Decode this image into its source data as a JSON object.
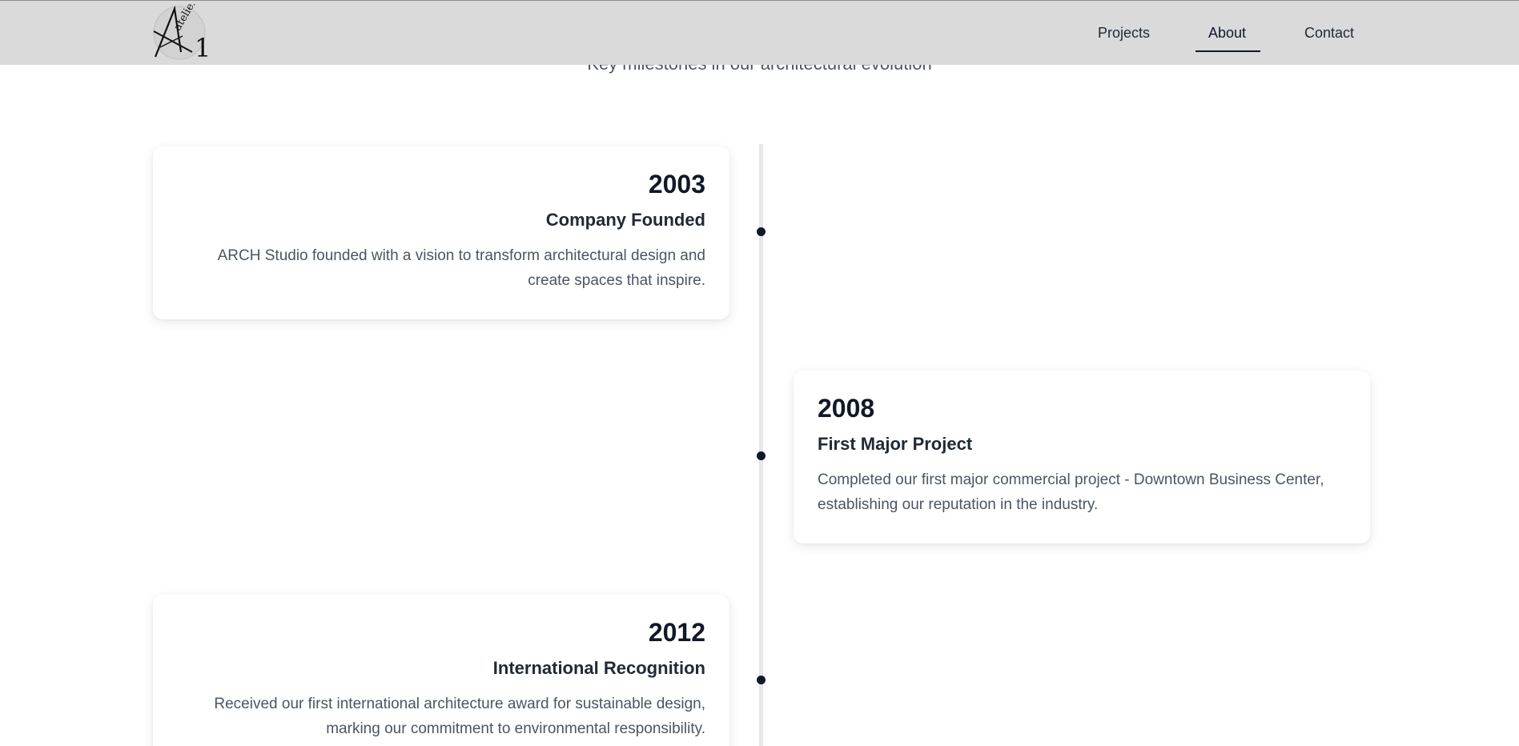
{
  "header": {
    "logo_text": "Atelier 1",
    "nav": [
      {
        "label": "Projects"
      },
      {
        "label": "About"
      },
      {
        "label": "Contact"
      }
    ],
    "active_nav": "About"
  },
  "section": {
    "subtitle": "Key milestones in our architectural evolution"
  },
  "timeline": [
    {
      "year": "2003",
      "title": "Company Founded",
      "description": "ARCH Studio founded with a vision to transform architectural design and create spaces that inspire."
    },
    {
      "year": "2008",
      "title": "First Major Project",
      "description": "Completed our first major commercial project - Downtown Business Center, establishing our reputation in the industry."
    },
    {
      "year": "2012",
      "title": "International Recognition",
      "description": "Received our first international architecture award for sustainable design, marking our commitment to environmental responsibility."
    }
  ],
  "colors": {
    "header_bg": "#dadada",
    "text_primary": "#111827",
    "text_secondary": "#4b5563",
    "timeline_line": "#e5e7eb"
  }
}
